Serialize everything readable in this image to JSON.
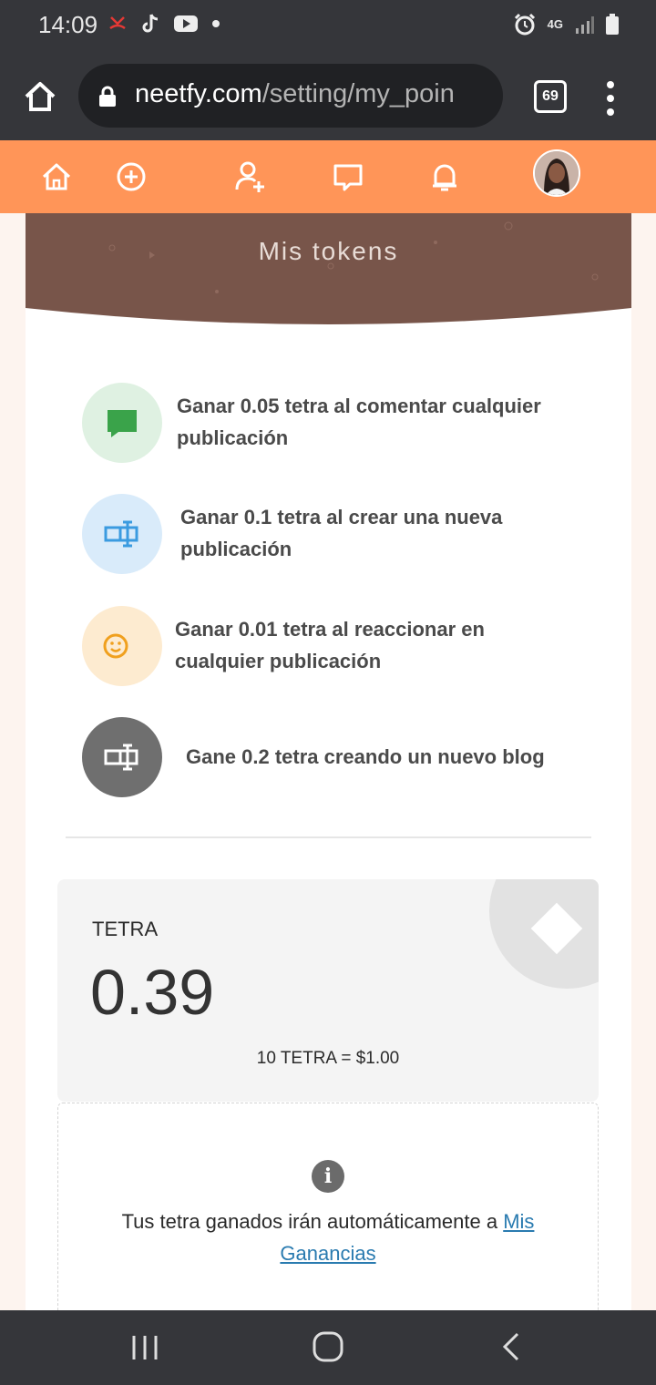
{
  "status_bar": {
    "time": "14:09",
    "network": "4G"
  },
  "browser": {
    "url_domain": "neetfy.com",
    "url_path": "/setting/my_poin",
    "tab_count": "69"
  },
  "banner": {
    "title": "Mis tokens"
  },
  "rewards": [
    {
      "text": "Ganar 0.05 tetra al comentar cualquier publicación",
      "icon": "comment-icon",
      "color": "#3aa34a"
    },
    {
      "text": "Ganar 0.1 tetra al crear una nueva publicación",
      "icon": "text-cursor-icon",
      "color": "#3b9be0"
    },
    {
      "text": "Ganar 0.01 tetra al reaccionar en cualquier publicación",
      "icon": "smiley-icon",
      "color": "#f0a01e"
    },
    {
      "text": "Gane 0.2 tetra creando un nuevo blog",
      "icon": "text-cursor-icon",
      "color": "#ffffff"
    }
  ],
  "wallet": {
    "label": "TETRA",
    "value": "0.39",
    "rate": "10 TETRA = $1.00"
  },
  "info": {
    "text": "Tus tetra ganados irán automáticamente a ",
    "link": "Mis Ganancias"
  },
  "colors": {
    "accent": "#ff9558",
    "banner": "#78554a",
    "chrome": "#35363a"
  }
}
